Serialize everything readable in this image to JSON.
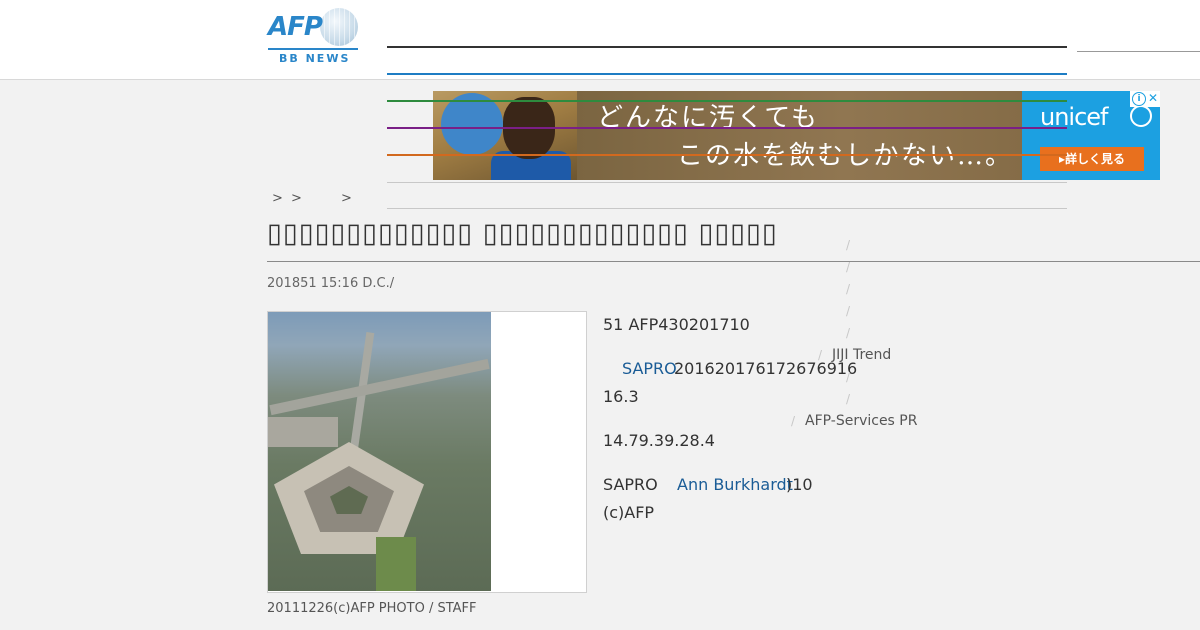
{
  "header": {
    "logo_text": "AFP",
    "logo_sub": "BB NEWS"
  },
  "ad": {
    "line1": "どんなに汚くても",
    "line2": "この水を飲むしかない…。",
    "brand": "unicef",
    "button": "▸詳しく見る",
    "info_icon": "i",
    "close_icon": "✕",
    "colors": {
      "brand": "#1ca0e1",
      "button": "#e8701e"
    }
  },
  "breadcrumb": {
    "sep1": ">",
    "sep2": ">",
    "sep3": ">"
  },
  "article": {
    "title": "▯▯▯▯▯▯▯▯▯▯▯▯▯ ▯▯▯▯▯▯▯▯▯▯▯▯▯ ▯▯▯▯▯",
    "meta": "201851 15:16  D.C./",
    "photo_caption": "20111226(c)AFP PHOTO / STAFF",
    "p1": "51 AFP430201710",
    "p2_link": "SAPRO",
    "p2_text": "20162017617267691​6",
    "p3": "16.3",
    "p4": "14.79.39.28.4",
    "p5_text": "SAPRO",
    "p5_link": "Ann Burkhardt",
    "p5_tail": ")10",
    "p6": "(c)AFP"
  },
  "side": {
    "slash": "/",
    "jiji": "JIJI Trend",
    "afp_services": "AFP-Services PR"
  }
}
